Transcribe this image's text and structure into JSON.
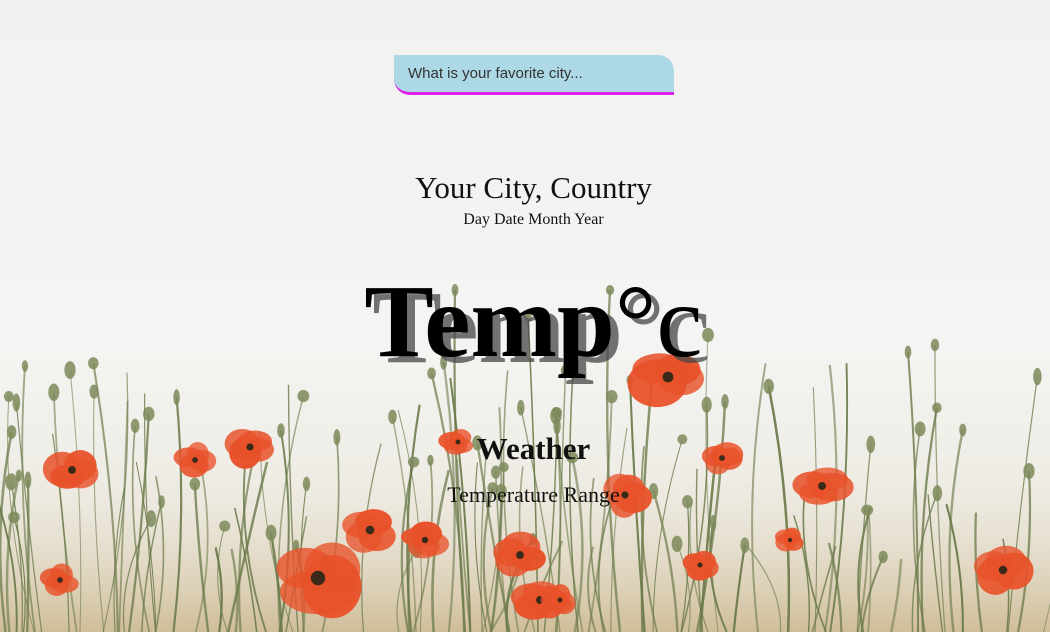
{
  "search": {
    "placeholder": "What is your favorite city..."
  },
  "location": {
    "city_country": "Your City, Country",
    "date": "Day Date Month Year"
  },
  "current": {
    "temp": "Temp",
    "unit": "°c",
    "weather": "Weather",
    "range": "Temperature Range"
  },
  "colors": {
    "search_bg": "#add8e6",
    "search_border": "#e020e8",
    "background": "#f3f3f1",
    "poppy": "#e8522a",
    "stem": "#6b7a4a"
  }
}
